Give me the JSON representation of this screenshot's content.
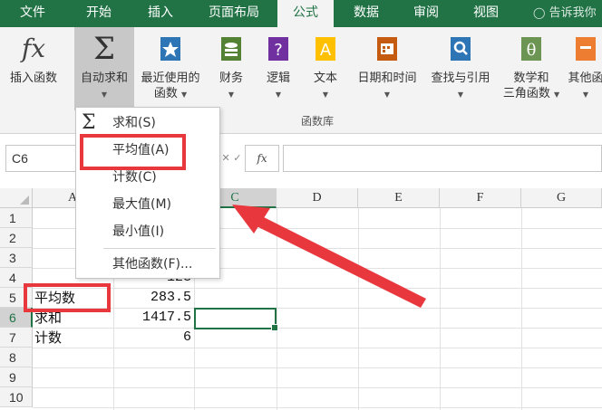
{
  "ribbon_tabs": [
    "文件",
    "开始",
    "插入",
    "页面布局",
    "公式",
    "数据",
    "审阅",
    "视图"
  ],
  "active_tab": "公式",
  "tell_me": "告诉我你",
  "ribbon": {
    "insert_function": "插入函数",
    "autosum": "自动求和",
    "recent_line1": "最近使用的",
    "recent_line2": "函数",
    "financial": "财务",
    "logical": "逻辑",
    "text": "文本",
    "datetime": "日期和时间",
    "lookup": "查找与引用",
    "math_line1": "数学和",
    "math_line2": "三角函数",
    "more": "其他函",
    "group_label": "函数库"
  },
  "formula_bar": {
    "name_box": "C6",
    "fx": "fx"
  },
  "dropdown": {
    "items": [
      "求和(S)",
      "平均值(A)",
      "计数(C)",
      "最大值(M)",
      "最小值(I)",
      "其他函数(F)..."
    ]
  },
  "columns": [
    "A",
    "B",
    "C",
    "D",
    "E",
    "F",
    "G"
  ],
  "rows": [
    "1",
    "2",
    "3",
    "4",
    "5",
    "6",
    "7",
    "8",
    "9",
    "10"
  ],
  "cells": {
    "B4": "123",
    "A5": "平均数",
    "B5": "283.5",
    "A6": "求和",
    "B6": "1417.5",
    "A7": "计数",
    "B7": "6"
  },
  "colors": {
    "excel_green": "#217346",
    "highlight_red": "#e8383d"
  }
}
